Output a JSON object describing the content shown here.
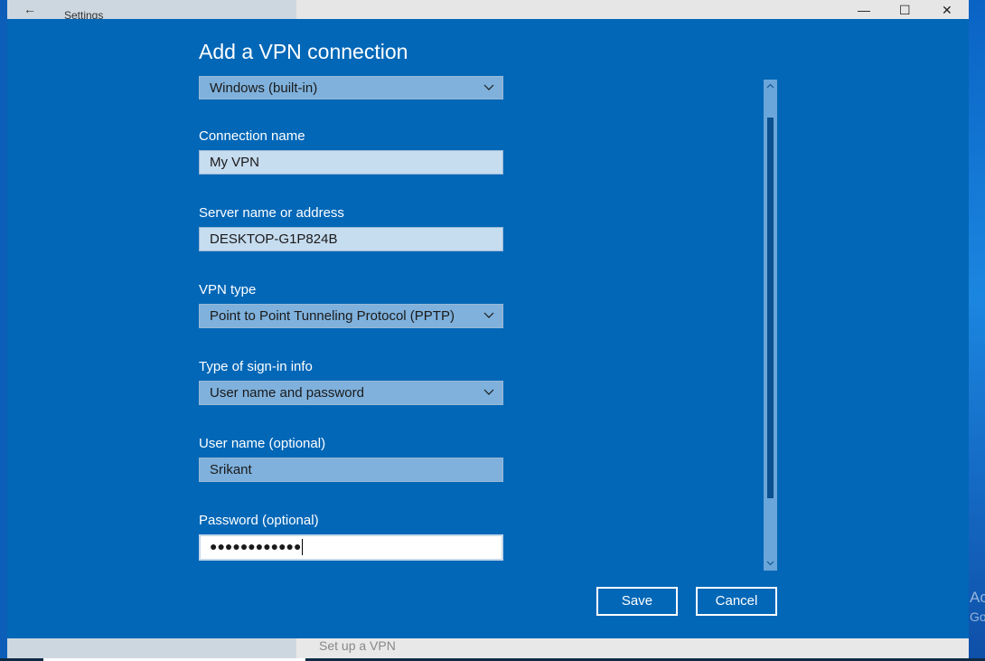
{
  "window": {
    "title": "Settings",
    "controls": {
      "minimize": "—",
      "maximize": "☐",
      "close": "✕"
    },
    "back_glyph": "←"
  },
  "dialog": {
    "title": "Add a VPN connection",
    "provider": {
      "value": "Windows (built-in)"
    },
    "connection_name": {
      "label": "Connection name",
      "value": "My VPN"
    },
    "server": {
      "label": "Server name or address",
      "value": "DESKTOP-G1P824B"
    },
    "vpn_type": {
      "label": "VPN type",
      "value": "Point to Point Tunneling Protocol (PPTP)"
    },
    "sign_in": {
      "label": "Type of sign-in info",
      "value": "User name and password"
    },
    "username": {
      "label": "User name (optional)",
      "value": "Srikant"
    },
    "password": {
      "label": "Password (optional)",
      "masked_value": "●●●●●●●●●●●●"
    },
    "save_label": "Save",
    "cancel_label": "Cancel"
  },
  "background": {
    "setup_text": "Set up a VPN",
    "watermark": [
      "Ac",
      "Go"
    ]
  },
  "colors": {
    "dialog_bg": "#0267b7",
    "field_light": "#c6dcef",
    "field_mid": "#7fb1dc",
    "accent_text": "#ffffff"
  },
  "icons": {
    "back": "back-arrow-icon",
    "dropdown": "chevron-down-icon",
    "scroll_up": "scroll-up-icon",
    "scroll_down": "scroll-down-icon"
  }
}
